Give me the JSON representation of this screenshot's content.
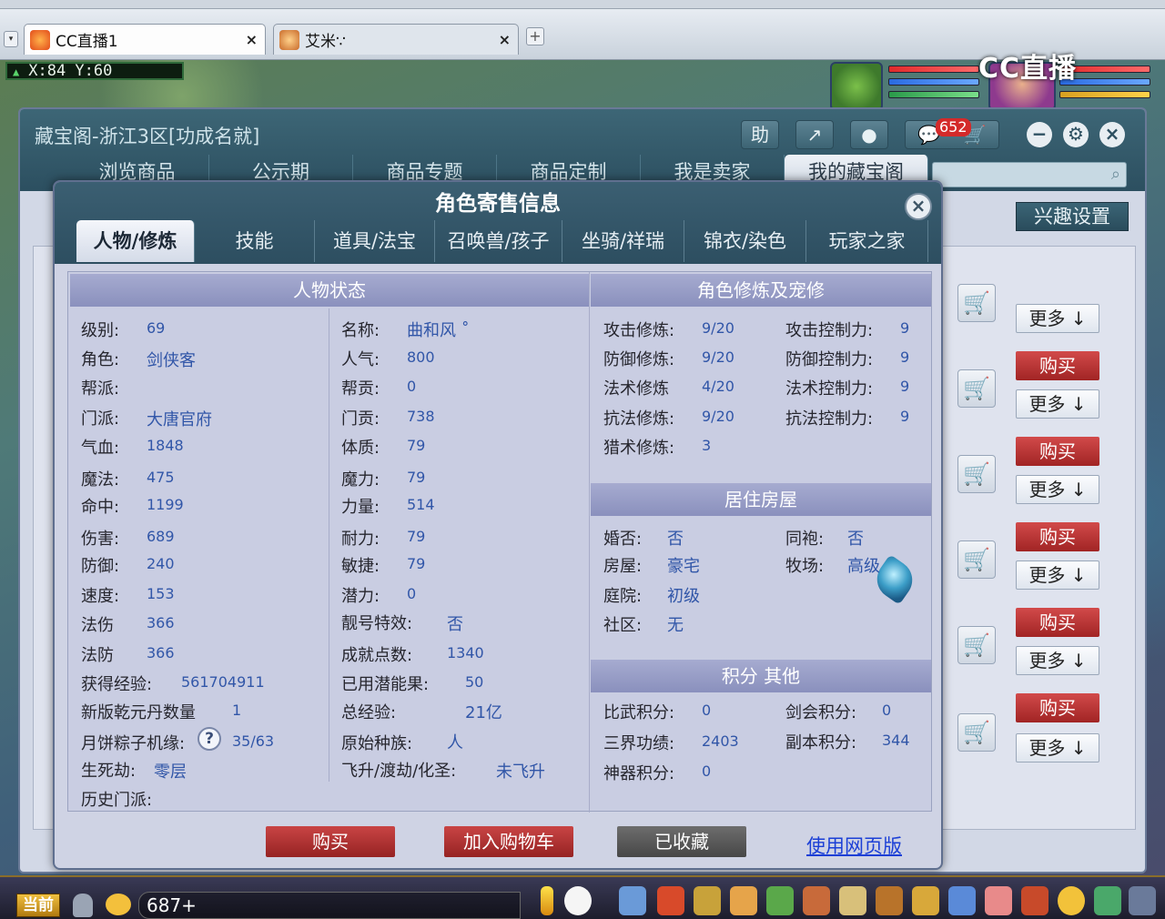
{
  "browser": {
    "tabs": [
      {
        "label": "CC直播1",
        "close": "×"
      },
      {
        "label": "艾米∵",
        "close": "×"
      }
    ],
    "new_tab": "+",
    "menu": "▾"
  },
  "game": {
    "coords": "X:84  Y:60",
    "watermark": "CC直播",
    "chat_count": "687+",
    "channel_label": "当前"
  },
  "window": {
    "title": "藏宝阁-浙江3区[功成名就]",
    "help_label": "助",
    "message_count": "652",
    "nav": [
      "浏览商品",
      "公示期",
      "商品专题",
      "商品定制",
      "我是卖家",
      "我的藏宝阁"
    ],
    "nav_active": 5,
    "interest_btn": "兴趣设置",
    "listing_buy": "购买",
    "listing_more": "更多",
    "listing_more_arrow": "↓"
  },
  "dialog": {
    "title": "角色寄售信息",
    "close": "×",
    "tabs": [
      "人物/修炼",
      "技能",
      "道具/法宝",
      "召唤兽/孩子",
      "坐骑/祥瑞",
      "锦衣/染色",
      "玩家之家"
    ],
    "tab_active": 0,
    "status": {
      "heading": "人物状态",
      "left": [
        {
          "label": "级别:",
          "value": "69"
        },
        {
          "label": "角色:",
          "value": "剑侠客"
        },
        {
          "label": "帮派:",
          "value": ""
        },
        {
          "label": "门派:",
          "value": "大唐官府"
        },
        {
          "label": "气血:",
          "value": "1848"
        },
        {
          "label": "魔法:",
          "value": "475"
        },
        {
          "label": "命中:",
          "value": "1199"
        },
        {
          "label": "伤害:",
          "value": "689"
        },
        {
          "label": "防御:",
          "value": "240"
        },
        {
          "label": "速度:",
          "value": "153"
        },
        {
          "label": "法伤",
          "value": "366"
        },
        {
          "label": "法防",
          "value": "366"
        },
        {
          "label": "获得经验:",
          "value": "561704911"
        },
        {
          "label": "新版乾元丹数量",
          "value": "1"
        },
        {
          "label": "月饼粽子机缘:",
          "value": "35/63"
        },
        {
          "label": "生死劫:",
          "value": "零层"
        },
        {
          "label": "历史门派:",
          "value": ""
        }
      ],
      "right": [
        {
          "label": "名称:",
          "value": "曲和风 ˚"
        },
        {
          "label": "人气:",
          "value": "800"
        },
        {
          "label": "帮贡:",
          "value": "0"
        },
        {
          "label": "门贡:",
          "value": "738"
        },
        {
          "label": "体质:",
          "value": "79"
        },
        {
          "label": "魔力:",
          "value": "79"
        },
        {
          "label": "力量:",
          "value": "514"
        },
        {
          "label": "耐力:",
          "value": "79"
        },
        {
          "label": "敏捷:",
          "value": "79"
        },
        {
          "label": "潜力:",
          "value": "0"
        },
        {
          "label": "靓号特效:",
          "value": "否"
        },
        {
          "label": "成就点数:",
          "value": "1340"
        },
        {
          "label": "已用潜能果:",
          "value": "50"
        },
        {
          "label": "总经验:",
          "value": "21亿"
        },
        {
          "label": "原始种族:",
          "value": "人"
        },
        {
          "label": "飞升/渡劫/化圣:",
          "value": "未飞升"
        }
      ],
      "help_mark": "?"
    },
    "cultivation": {
      "heading": "角色修炼及宠修",
      "rows": [
        {
          "l1": "攻击修炼:",
          "v1": "9/20",
          "l2": "攻击控制力:",
          "v2": "9"
        },
        {
          "l1": "防御修炼:",
          "v1": "9/20",
          "l2": "防御控制力:",
          "v2": "9"
        },
        {
          "l1": "法术修炼",
          "v1": "4/20",
          "l2": "法术控制力:",
          "v2": "9"
        },
        {
          "l1": "抗法修炼:",
          "v1": "9/20",
          "l2": "抗法控制力:",
          "v2": "9"
        },
        {
          "l1": "猎术修炼:",
          "v1": "3",
          "l2": "",
          "v2": ""
        }
      ]
    },
    "housing": {
      "heading": "居住房屋",
      "rows": [
        {
          "l1": "婚否:",
          "v1": "否",
          "l2": "同袍:",
          "v2": "否"
        },
        {
          "l1": "房屋:",
          "v1": "豪宅",
          "l2": "牧场:",
          "v2": "高级"
        },
        {
          "l1": "庭院:",
          "v1": "初级",
          "l2": "",
          "v2": ""
        },
        {
          "l1": "社区:",
          "v1": "无",
          "l2": "",
          "v2": ""
        }
      ]
    },
    "points": {
      "heading": "积分 其他",
      "rows": [
        {
          "l1": "比武积分:",
          "v1": "0",
          "l2": "剑会积分:",
          "v2": "0"
        },
        {
          "l1": "三界功绩:",
          "v1": "2403",
          "l2": "副本积分:",
          "v2": "344"
        },
        {
          "l1": "神器积分:",
          "v1": "0",
          "l2": "",
          "v2": ""
        }
      ]
    },
    "actions": {
      "buy": "购买",
      "add_cart": "加入购物车",
      "favorited": "已收藏",
      "web_version": "使用网页版"
    }
  }
}
